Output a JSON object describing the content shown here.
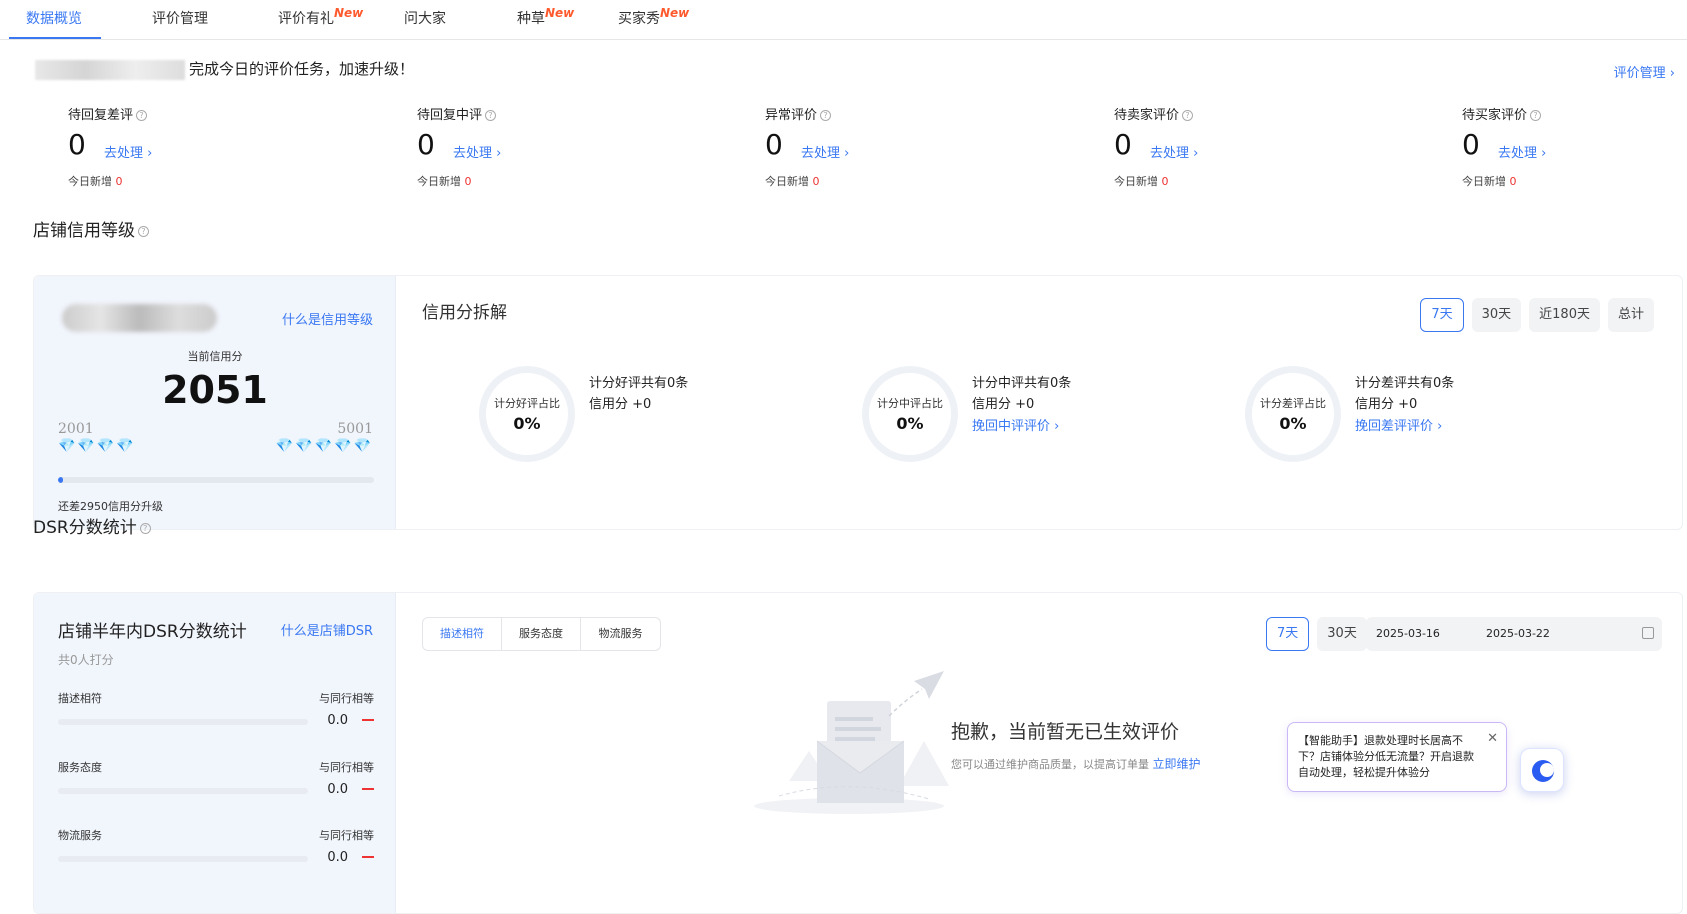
{
  "tabs": [
    {
      "label": "数据概览",
      "new": ""
    },
    {
      "label": "评价管理",
      "new": ""
    },
    {
      "label": "评价有礼",
      "new": "New"
    },
    {
      "label": "问大家",
      "new": ""
    },
    {
      "label": "种草",
      "new": "New"
    },
    {
      "label": "买家秀",
      "new": "New"
    }
  ],
  "banner": {
    "text": "完成今日的评价任务，加速升级！",
    "link": "评价管理 ›"
  },
  "stats": [
    {
      "title": "待回复差评",
      "value": "0",
      "link": "去处理 ›",
      "today_label": "今日新增",
      "today_value": "0"
    },
    {
      "title": "待回复中评",
      "value": "0",
      "link": "去处理 ›",
      "today_label": "今日新增",
      "today_value": "0"
    },
    {
      "title": "异常评价",
      "value": "0",
      "link": "去处理 ›",
      "today_label": "今日新增",
      "today_value": "0"
    },
    {
      "title": "待卖家评价",
      "value": "0",
      "link": "去处理 ›",
      "today_label": "今日新增",
      "today_value": "0"
    },
    {
      "title": "待买家评价",
      "value": "0",
      "link": "去处理 ›",
      "today_label": "今日新增",
      "today_value": "0"
    }
  ],
  "credit": {
    "section_title": "店铺信用等级",
    "what_link": "什么是信用等级",
    "current_label": "当前信用分",
    "current_value": "2051",
    "range_low": "2001",
    "range_high": "5001",
    "diamonds_blue": "💎💎💎💎",
    "diamonds_grey": "💎💎💎💎💎",
    "progress_fraction": 0.017,
    "upgrade_text": "还差2950信用分升级",
    "breakdown_title": "信用分拆解",
    "periods": [
      "7天",
      "30天",
      "近180天",
      "总计"
    ],
    "breakdown": [
      {
        "ring_label": "计分好评占比",
        "ring_value": "0%",
        "line1": "计分好评共有0条",
        "line2": "信用分 +0",
        "link": ""
      },
      {
        "ring_label": "计分中评占比",
        "ring_value": "0%",
        "line1": "计分中评共有0条",
        "line2": "信用分 +0",
        "link": "挽回中评评价 ›"
      },
      {
        "ring_label": "计分差评占比",
        "ring_value": "0%",
        "line1": "计分差评共有0条",
        "line2": "信用分 +0",
        "link": "挽回差评评价 ›"
      }
    ]
  },
  "dsr": {
    "section_title": "DSR分数统计",
    "title": "店铺半年内DSR分数统计",
    "what_link": "什么是店铺DSR",
    "count": "共0人打分",
    "metrics": [
      {
        "name": "描述相符",
        "compare": "与同行相等",
        "value": "0.0"
      },
      {
        "name": "服务态度",
        "compare": "与同行相等",
        "value": "0.0"
      },
      {
        "name": "物流服务",
        "compare": "与同行相等",
        "value": "0.0"
      }
    ],
    "segments": [
      "描述相符",
      "服务态度",
      "物流服务"
    ],
    "periods": [
      "7天",
      "30天"
    ],
    "date_start": "2025-03-16",
    "date_end": "2025-03-22",
    "empty_title": "抱歉，当前暂无已生效评价",
    "empty_sub": "您可以通过维护商品质量，以提高订单量",
    "empty_link": "立即维护"
  },
  "assistant": {
    "text": "【智能助手】退款处理时长居高不下？店铺体验分低无流量？开启退款自动处理，轻松提升体验分",
    "close": "✕"
  },
  "colors": {
    "accent": "#3a78f2",
    "new_badge": "#ff5a2d",
    "negative": "#e33333"
  }
}
